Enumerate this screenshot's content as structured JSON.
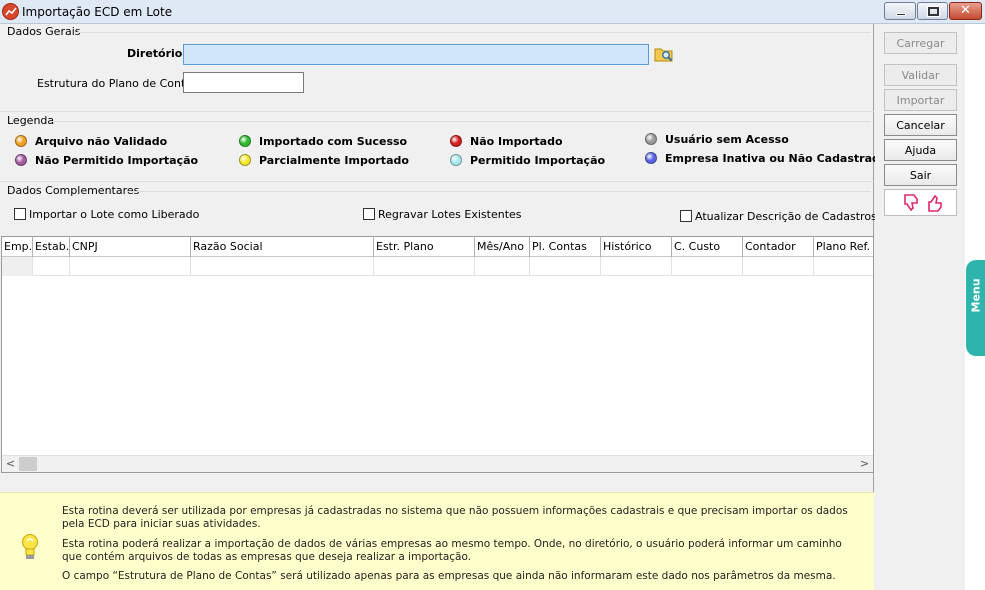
{
  "window": {
    "title": "Importação ECD em Lote",
    "controls": {
      "minimize": "",
      "maximize": "",
      "close": "✕"
    }
  },
  "dados_gerais": {
    "label": "Dados Gerais",
    "diretorio_label": "Diretório",
    "diretorio_value": "",
    "estrutura_label": "Estrutura do Plano de Contas",
    "estrutura_value": ""
  },
  "legenda": {
    "label": "Legenda",
    "items": [
      {
        "label": "Arquivo não Validado",
        "color": "#f0a01e"
      },
      {
        "label": "Importado com Sucesso",
        "color": "#2dbb2d"
      },
      {
        "label": "Não Importado",
        "color": "#d21e1e"
      },
      {
        "label": "Usuário sem Acesso",
        "color": "#9a9a9a"
      },
      {
        "label": "Não Permitido Importação",
        "color": "#a05aa0"
      },
      {
        "label": "Parcialmente Importado",
        "color": "#f5e628"
      },
      {
        "label": "Permitido Importação",
        "color": "#a8e6ec"
      },
      {
        "label": "Empresa Inativa ou Não Cadastrada",
        "color": "#5a64e6"
      }
    ]
  },
  "dados_complementares": {
    "label": "Dados Complementares",
    "checkboxes": [
      {
        "label": "Importar o Lote como Liberado",
        "checked": false
      },
      {
        "label": "Regravar Lotes Existentes",
        "checked": false
      },
      {
        "label": "Atualizar Descrição de Cadastros",
        "checked": false
      }
    ]
  },
  "grid": {
    "columns": [
      "Emp.",
      "Estab.",
      "CNPJ",
      "Razão Social",
      "Estr. Plano",
      "Mês/Ano",
      "Pl. Contas",
      "Histórico",
      "C. Custo",
      "Contador",
      "Plano Ref."
    ],
    "scroll_left": "<",
    "scroll_right": ">"
  },
  "info": {
    "paragraphs": [
      "Esta rotina deverá ser utilizada por empresas já cadastradas no sistema que não possuem informações cadastrais e que precisam importar os dados pela ECD para iniciar suas atividades.",
      "Esta rotina poderá realizar a importação de dados de várias empresas ao mesmo tempo. Onde, no diretório, o usuário poderá informar um caminho que contém arquivos de todas as empresas que deseja realizar a importação.",
      "O campo “Estrutura de Plano de Contas” será utilizado apenas para as empresas que ainda não informaram este dado nos parâmetros da mesma."
    ]
  },
  "sidebar": {
    "buttons": [
      {
        "label": "Carregar",
        "enabled": false
      },
      {
        "label": "Validar",
        "enabled": false
      },
      {
        "label": "Importar",
        "enabled": false
      },
      {
        "label": "Cancelar",
        "enabled": true
      },
      {
        "label": "Ajuda",
        "enabled": true
      },
      {
        "label": "Sair",
        "enabled": true
      }
    ]
  },
  "menu_tab": {
    "label": "Menu"
  },
  "colors": {
    "accent_teal": "#2db5ad",
    "info_bg": "#ffffcc",
    "focus_input": "#cfe6fb"
  }
}
